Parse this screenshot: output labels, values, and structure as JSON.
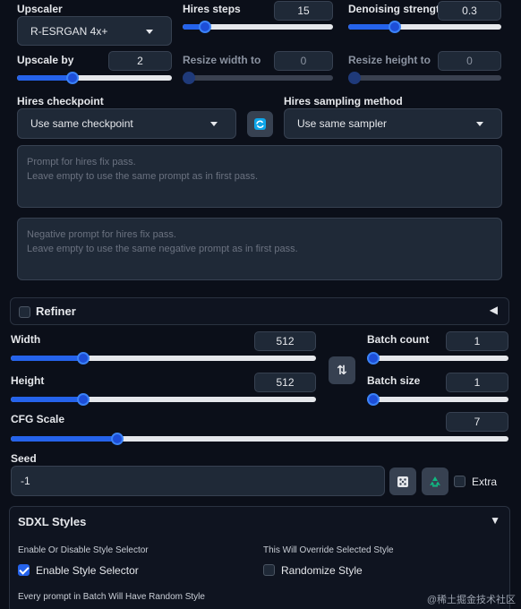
{
  "hires": {
    "upscaler_label": "Upscaler",
    "upscaler_value": "R-ESRGAN 4x+",
    "hires_steps_label": "Hires steps",
    "hires_steps_value": "15",
    "hires_steps_fraction": 0.15,
    "denoising_label": "Denoising strength",
    "denoising_value": "0.3",
    "denoising_fraction": 0.3,
    "upscale_by_label": "Upscale by",
    "upscale_by_value": "2",
    "upscale_by_fraction": 0.33,
    "resize_width_label": "Resize width to",
    "resize_width_value": "0",
    "resize_height_label": "Resize height to",
    "resize_height_value": "0",
    "checkpoint_label": "Hires checkpoint",
    "checkpoint_value": "Use same checkpoint",
    "sampling_label": "Hires sampling method",
    "sampling_value": "Use same sampler",
    "prompt_placeholder_line1": "Prompt for hires fix pass.",
    "prompt_placeholder_line2": "Leave empty to use the same prompt as in first pass.",
    "neg_prompt_placeholder_line1": "Negative prompt for hires fix pass.",
    "neg_prompt_placeholder_line2": "Leave empty to use the same negative prompt as in first pass."
  },
  "refiner": {
    "label": "Refiner",
    "toggle_glyph": "◀"
  },
  "size": {
    "width_label": "Width",
    "width_value": "512",
    "width_fraction": 0.24,
    "height_label": "Height",
    "height_value": "512",
    "height_fraction": 0.24,
    "swap_glyph": "⇅",
    "batch_count_label": "Batch count",
    "batch_count_value": "1",
    "batch_size_label": "Batch size",
    "batch_size_value": "1"
  },
  "cfg": {
    "label": "CFG Scale",
    "value": "7",
    "fraction": 0.2
  },
  "seed": {
    "label": "Seed",
    "value": "-1",
    "extra_label": "Extra"
  },
  "sdxl": {
    "title": "SDXL Styles",
    "toggle_glyph": "▼",
    "enable_header": "Enable Or Disable Style Selector",
    "override_header": "This Will Override Selected Style",
    "enable_label": "Enable Style Selector",
    "randomize_label": "Randomize Style",
    "footer": "Every prompt in Batch Will Have Random Style"
  },
  "watermark": "@稀土掘金技术社区",
  "colors": {
    "accent": "#2563eb",
    "background": "#0b0f19",
    "recycle": "#10b981"
  }
}
